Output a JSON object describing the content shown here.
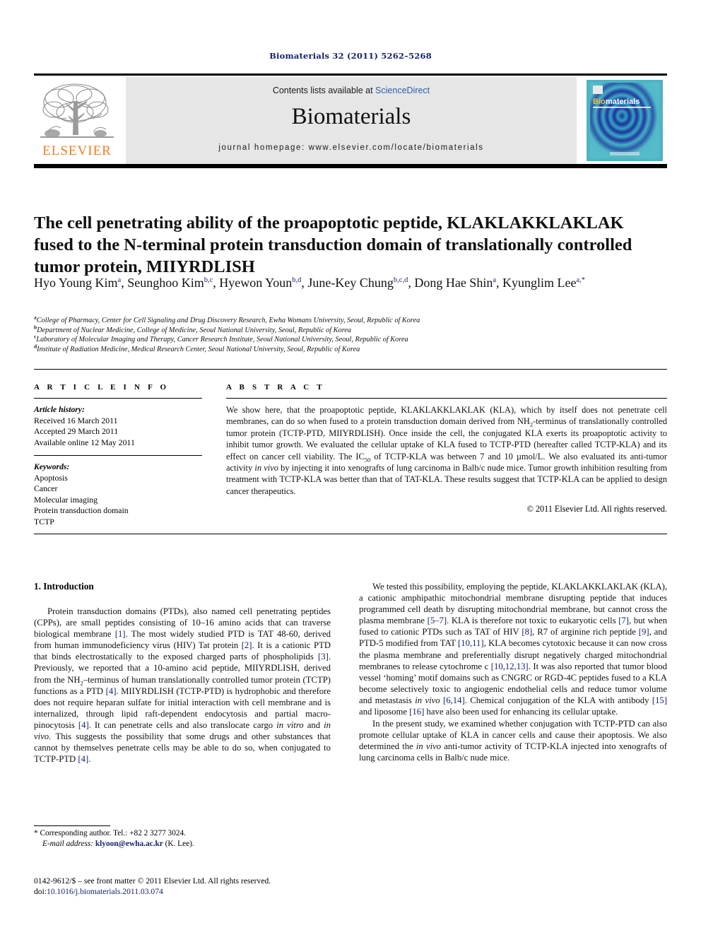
{
  "running_head": "Biomaterials 32 (2011) 5262–5268",
  "masthead": {
    "contents_prefix": "Contents lists available at ",
    "sciencedirect": "ScienceDirect",
    "journal_name": "Biomaterials",
    "homepage": "journal homepage: www.elsevier.com/locate/biomaterials",
    "publisher_wordmark": "ELSEVIER",
    "publisher_logo_icon": "elsevier-tree-icon",
    "cover_icon": "biomaterials-cover-thumbnail",
    "cover_title_bio": "Bio",
    "cover_title_materials": "materials",
    "accent_orange": "#ef7d22",
    "link_blue": "#2b5fae",
    "panel_gray": "#e6e6e6"
  },
  "article": {
    "title": "The cell penetrating ability of the proapoptotic peptide, KLAKLAKKLAKLAK fused to the N-terminal protein transduction domain of translationally controlled tumor protein, MIIYRDLISH",
    "authors": [
      {
        "name": "Hyo Young Kim",
        "marks": "a",
        "sep": ", "
      },
      {
        "name": "Seunghoo Kim",
        "marks": "b,c",
        "sep": ", "
      },
      {
        "name": "Hyewon Youn",
        "marks": "b,d",
        "sep": ", "
      },
      {
        "name": "June-Key Chung",
        "marks": "b,c,d",
        "sep": ", "
      },
      {
        "name": "Dong Hae Shin",
        "marks": "a",
        "sep": ", "
      },
      {
        "name": "Kyunglim Lee",
        "marks": "a,*",
        "sep": ""
      }
    ],
    "affiliations": [
      {
        "mark": "a",
        "text": "College of Pharmacy, Center for Cell Signaling and Drug Discovery Research, Ewha Womans University, Seoul, Republic of Korea"
      },
      {
        "mark": "b",
        "text": "Department of Nuclear Medicine, College of Medicine, Seoul National University, Seoul, Republic of Korea"
      },
      {
        "mark": "c",
        "text": "Laboratory of Molecular Imaging and Therapy, Cancer Research Institute, Seoul National University, Seoul, Republic of Korea"
      },
      {
        "mark": "d",
        "text": "Institute of Radiation Medicine, Medical Research Center, Seoul National University, Seoul, Republic of Korea"
      }
    ]
  },
  "article_info": {
    "heading": "A R T I C L E  I N F O",
    "history_label": "Article history:",
    "history": [
      "Received 16 March 2011",
      "Accepted 29 March 2011",
      "Available online 12 May 2011"
    ],
    "keywords_label": "Keywords:",
    "keywords": [
      "Apoptosis",
      "Cancer",
      "Molecular imaging",
      "Protein transduction domain",
      "TCTP"
    ]
  },
  "abstract": {
    "heading": "A B S T R A C T",
    "copyright": "© 2011 Elsevier Ltd. All rights reserved."
  },
  "introduction": {
    "heading": "1. Introduction"
  },
  "footnote": {
    "corresponding": "* Corresponding author. Tel.: +82 2 3277 3024.",
    "email_label": "E-mail address:",
    "email": "klyoon@ewha.ac.kr",
    "email_owner": "(K. Lee)."
  },
  "colophon": {
    "issn_line": "0142-9612/$ – see front matter © 2011 Elsevier Ltd. All rights reserved.",
    "doi_prefix": "doi:",
    "doi": "10.1016/j.biomaterials.2011.03.074"
  }
}
